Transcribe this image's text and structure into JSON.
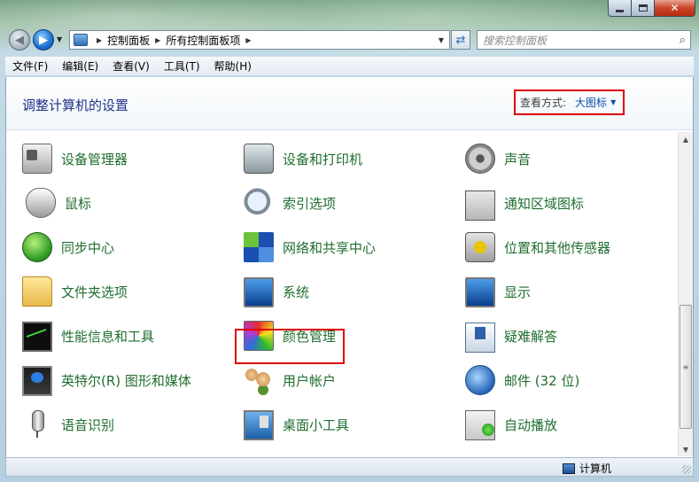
{
  "window": {
    "caption_buttons": [
      "minimize-icon",
      "maximize-icon",
      "close-icon"
    ]
  },
  "navbar": {
    "breadcrumb": [
      "控制面板",
      "所有控制面板项"
    ],
    "search_placeholder": "搜索控制面板"
  },
  "menu": [
    "文件(F)",
    "编辑(E)",
    "查看(V)",
    "工具(T)",
    "帮助(H)"
  ],
  "header": {
    "title": "调整计算机的设置",
    "view_label": "查看方式:",
    "view_value": "大图标"
  },
  "items": [
    {
      "label": "设备管理器",
      "icon": "device-manager-icon"
    },
    {
      "label": "设备和打印机",
      "icon": "printer-icon"
    },
    {
      "label": "声音",
      "icon": "speaker-icon"
    },
    {
      "label": "鼠标",
      "icon": "mouse-icon"
    },
    {
      "label": "索引选项",
      "icon": "magnifier-icon"
    },
    {
      "label": "通知区域图标",
      "icon": "notification-area-icon"
    },
    {
      "label": "同步中心",
      "icon": "sync-icon"
    },
    {
      "label": "网络和共享中心",
      "icon": "network-icon"
    },
    {
      "label": "位置和其他传感器",
      "icon": "location-sensor-icon"
    },
    {
      "label": "文件夹选项",
      "icon": "folder-options-icon"
    },
    {
      "label": "系统",
      "icon": "system-icon"
    },
    {
      "label": "显示",
      "icon": "display-icon"
    },
    {
      "label": "性能信息和工具",
      "icon": "performance-icon"
    },
    {
      "label": "颜色管理",
      "icon": "color-management-icon"
    },
    {
      "label": "疑难解答",
      "icon": "troubleshooting-icon"
    },
    {
      "label": "英特尔(R) 图形和媒体",
      "icon": "intel-graphics-icon"
    },
    {
      "label": "用户帐户",
      "icon": "user-accounts-icon"
    },
    {
      "label": "邮件 (32 位)",
      "icon": "mail-icon"
    },
    {
      "label": "语音识别",
      "icon": "microphone-icon"
    },
    {
      "label": "桌面小工具",
      "icon": "desktop-gadgets-icon"
    },
    {
      "label": "自动播放",
      "icon": "autoplay-icon"
    }
  ],
  "status": {
    "computer": "计算机"
  }
}
